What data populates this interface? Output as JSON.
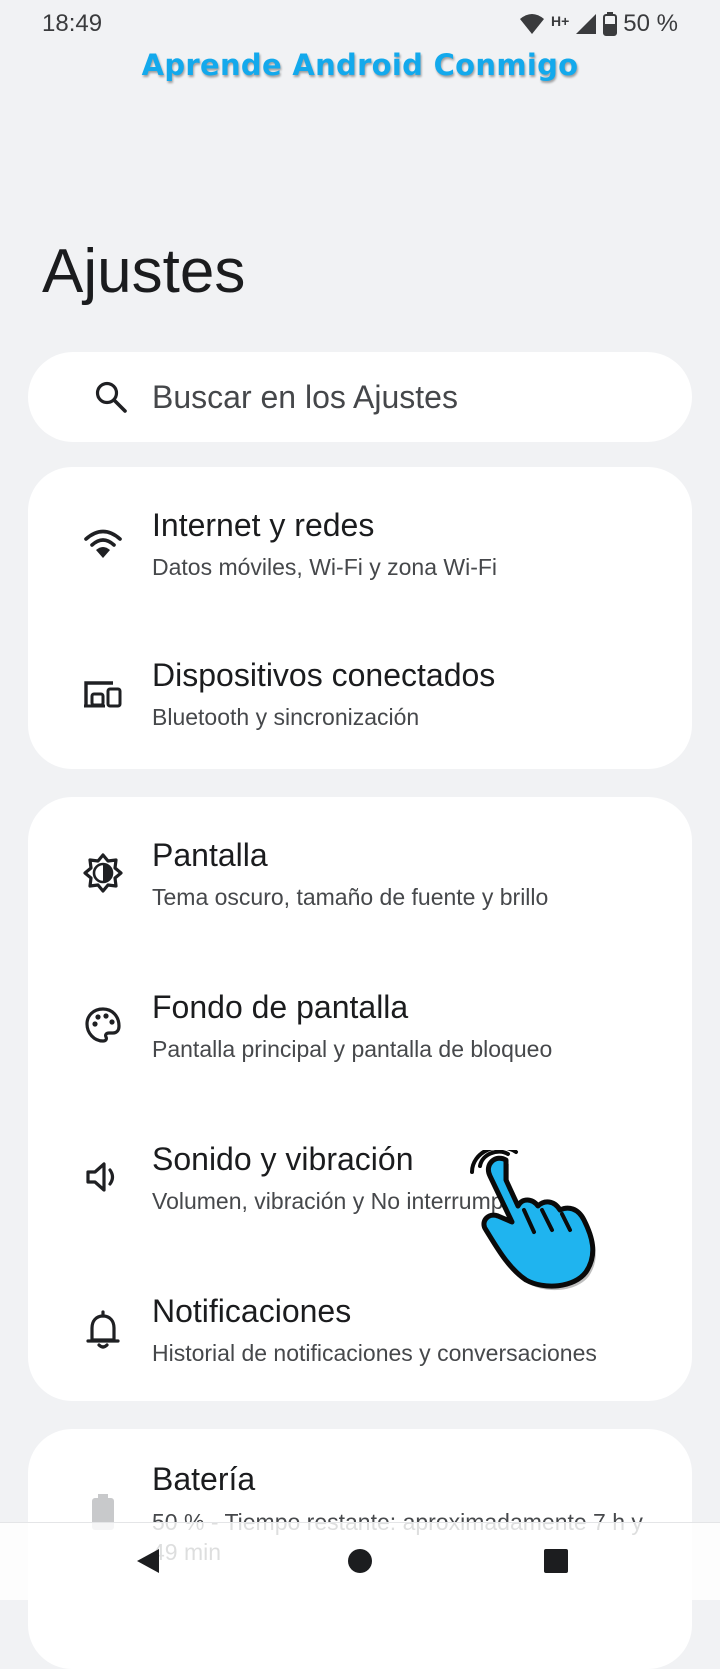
{
  "status_bar": {
    "time": "18:49",
    "network": "H+",
    "battery": "50 %"
  },
  "watermark": "Aprende Android Conmigo",
  "page_title": "Ajustes",
  "search": {
    "placeholder": "Buscar en los Ajustes"
  },
  "sections": [
    {
      "items": [
        {
          "title": "Internet y redes",
          "subtitle": "Datos móviles, Wi-Fi y zona Wi-Fi",
          "icon": "wifi-icon"
        },
        {
          "title": "Dispositivos conectados",
          "subtitle": "Bluetooth y sincronización",
          "icon": "devices-icon"
        }
      ]
    },
    {
      "items": [
        {
          "title": "Pantalla",
          "subtitle": "Tema oscuro, tamaño de fuente y brillo",
          "icon": "brightness-icon"
        },
        {
          "title": "Fondo de pantalla",
          "subtitle": "Pantalla principal y pantalla de bloqueo",
          "icon": "palette-icon"
        },
        {
          "title": "Sonido y vibración",
          "subtitle": "Volumen, vibración y No interrumpir",
          "icon": "volume-icon"
        },
        {
          "title": "Notificaciones",
          "subtitle": "Historial de notificaciones y conversaciones",
          "icon": "bell-icon"
        }
      ]
    },
    {
      "items": [
        {
          "title": "Batería",
          "subtitle": "50 % - Tiempo restante: aproximadamente 7 h y 49 min",
          "icon": "battery-icon"
        }
      ]
    }
  ],
  "nav": {
    "back": "back-icon",
    "home": "home-icon",
    "recents": "recents-icon"
  },
  "colors": {
    "background": "#f1f2f4",
    "card": "#ffffff",
    "watermark": "#13a9ec",
    "hand_pointer": "#1fb4ef"
  }
}
